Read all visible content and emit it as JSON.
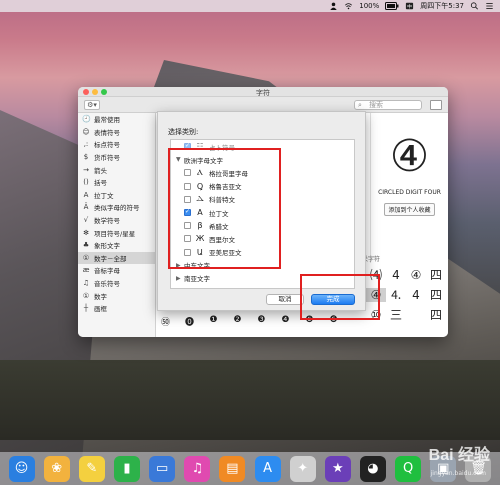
{
  "menubar": {
    "battery": "100%",
    "datetime": "周四下午5:37"
  },
  "window": {
    "title": "字符",
    "search_placeholder": "搜索"
  },
  "sidebar": {
    "items": [
      {
        "icon": "🕘",
        "label": "最常使用"
      },
      {
        "icon": "☺",
        "label": "表情符号"
      },
      {
        "icon": ",:",
        "label": "标点符号"
      },
      {
        "icon": "$",
        "label": "货币符号"
      },
      {
        "icon": "→",
        "label": "箭头"
      },
      {
        "icon": "()",
        "label": "括号"
      },
      {
        "icon": "A",
        "label": "拉丁文"
      },
      {
        "icon": "Ä",
        "label": "类似字母的符号"
      },
      {
        "icon": "√",
        "label": "数学符号"
      },
      {
        "icon": "✻",
        "label": "项目符号/星星"
      },
      {
        "icon": "♣",
        "label": "象形文字"
      },
      {
        "icon": "①",
        "label": "数字－全部"
      },
      {
        "icon": "æ",
        "label": "音标字母"
      },
      {
        "icon": "♫",
        "label": "音乐符号"
      },
      {
        "icon": "①",
        "label": "数字"
      },
      {
        "icon": "┼",
        "label": "画框"
      }
    ]
  },
  "detail": {
    "big_char": "④",
    "char_name": "CIRCLED DIGIT FOUR",
    "add_favorite": "添加到个人收藏",
    "related_label": "关字符",
    "related": [
      "⑷",
      "4",
      "④",
      "四",
      "④",
      "⒋",
      "4",
      "四",
      "⑩",
      "三",
      "",
      "四"
    ]
  },
  "bottom_row": [
    "㊿",
    "⓿",
    "❶",
    "❷",
    "❸",
    "❹",
    "❺",
    "❻"
  ],
  "sheet": {
    "title": "选择类别:",
    "items": [
      {
        "kind": "child",
        "checked": true,
        "glyph": "☷",
        "label": "占卜符号",
        "faded": true
      },
      {
        "kind": "group",
        "label": "欧洲字母文字"
      },
      {
        "kind": "child",
        "checked": false,
        "glyph": "Ⲁ",
        "label": "格拉哥里字母"
      },
      {
        "kind": "child",
        "checked": false,
        "glyph": "Ꝗ",
        "label": "格鲁吉亚文"
      },
      {
        "kind": "child",
        "checked": false,
        "glyph": "Ⲇ",
        "label": "科普特文"
      },
      {
        "kind": "child",
        "checked": true,
        "glyph": "A",
        "label": "拉丁文"
      },
      {
        "kind": "child",
        "checked": false,
        "glyph": "β",
        "label": "希腊文"
      },
      {
        "kind": "child",
        "checked": false,
        "glyph": "Ж",
        "label": "西里尔文"
      },
      {
        "kind": "child",
        "checked": false,
        "glyph": "Ա",
        "label": "亚美尼亚文"
      },
      {
        "kind": "group-collapsed",
        "label": "中东文字"
      },
      {
        "kind": "group-collapsed",
        "label": "南亚文字"
      }
    ],
    "cancel_label": "取消",
    "done_label": "完成"
  },
  "dock": {
    "icons": [
      {
        "name": "finder-icon",
        "glyph": "☺",
        "color": "#2a7fe0"
      },
      {
        "name": "photos-icon",
        "glyph": "❀",
        "color": "#f2b23e"
      },
      {
        "name": "notes-icon",
        "glyph": "✎",
        "color": "#f4d03f"
      },
      {
        "name": "numbers-icon",
        "glyph": "▮",
        "color": "#2db24a"
      },
      {
        "name": "keynote-icon",
        "glyph": "▭",
        "color": "#3a79d8"
      },
      {
        "name": "itunes-icon",
        "glyph": "♫",
        "color": "#e04ab0"
      },
      {
        "name": "ibooks-icon",
        "glyph": "▤",
        "color": "#f08a24"
      },
      {
        "name": "app-store-icon",
        "glyph": "A",
        "color": "#2d8cf0"
      },
      {
        "name": "color-picker-icon",
        "glyph": "✦",
        "color": "#d0d0d0"
      },
      {
        "name": "imovie-icon",
        "glyph": "★",
        "color": "#6b3fb8"
      },
      {
        "name": "qq-icon",
        "glyph": "◕",
        "color": "#222222"
      },
      {
        "name": "iqiyi-icon",
        "glyph": "Q",
        "color": "#1fbf3f"
      },
      {
        "name": "preview-icon",
        "glyph": "▣",
        "color": "#9aa4b0"
      },
      {
        "name": "trash-icon",
        "glyph": "🗑",
        "color": "#b0b0b0"
      }
    ]
  },
  "watermark": {
    "text": "Bai 经验",
    "sub": "jingyan.baidu.com"
  }
}
